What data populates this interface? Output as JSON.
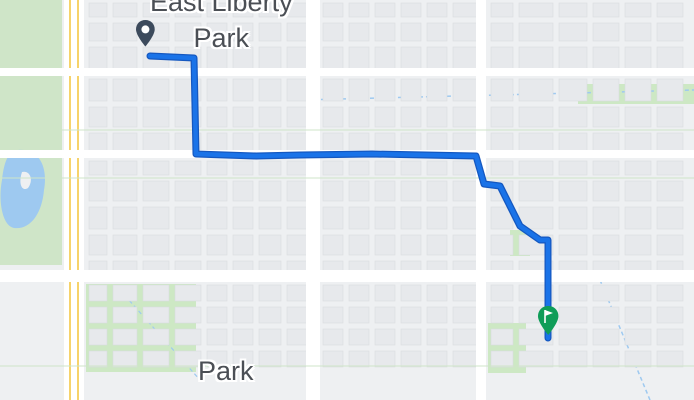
{
  "map": {
    "place_labels": [
      {
        "line1": "East Liberty",
        "line2": "Park"
      },
      {
        "line1": "Park"
      }
    ],
    "route_color": "#1a73e8",
    "route_outline_color": "#1558c0",
    "start_marker_color": "#3c4a5c",
    "end_marker_color": "#0f9d58",
    "park_color": "#cde8c4",
    "water_color": "#9ec9f0"
  }
}
